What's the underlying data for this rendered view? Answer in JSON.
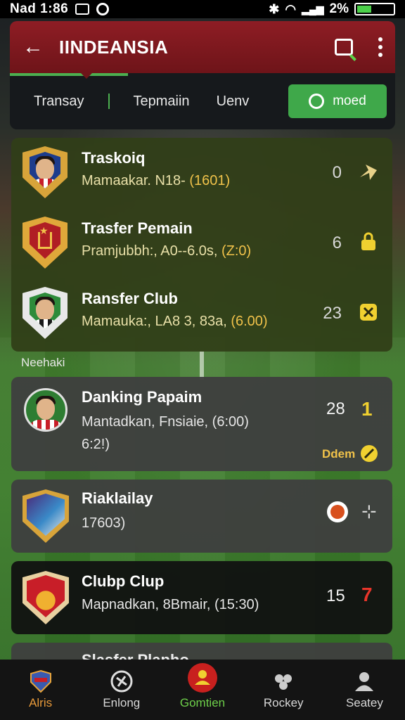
{
  "status_bar": {
    "time": "Nad 1:86",
    "battery": "2%"
  },
  "header": {
    "title": "IINDEANSIA"
  },
  "tabs": {
    "items": [
      "Transay",
      "Tepmaiin",
      "Uenv"
    ],
    "mode_button": "moed"
  },
  "featured": [
    {
      "name": "Traskoiq",
      "detail": "Mamaakar. N18- ",
      "highlight": "(1601)",
      "value": "0"
    },
    {
      "name": "Trasfer Pemain",
      "detail": "Pramjubbh:, A0--6.0s, ",
      "highlight": "(Z:0)",
      "value": "6"
    },
    {
      "name": "Ransfer Club",
      "detail": "Mamauka:, LA8 3, 83a, ",
      "highlight": "(6.00)",
      "value": "23"
    }
  ],
  "section_label": "Neehaki",
  "cards": [
    {
      "name": "Danking Papaim",
      "detail": "Mantadkan, Fnsiaie, (6:00)",
      "detail2": "6:2!)",
      "value": "28",
      "rank": "1",
      "tag": "Ddem"
    },
    {
      "name": "Riaklailay",
      "detail": "17603)"
    },
    {
      "name": "Clubp Clup",
      "detail": "Mapnadkan, 8Bmair, (15:30)",
      "value": "15",
      "rank": "7"
    }
  ],
  "peek_card": {
    "name": "Slasfer Plapho"
  },
  "bottom_nav": [
    {
      "label": "Alris"
    },
    {
      "label": "Enlong"
    },
    {
      "label": "Gomtien"
    },
    {
      "label": "Rockey"
    },
    {
      "label": "Seatey"
    }
  ]
}
